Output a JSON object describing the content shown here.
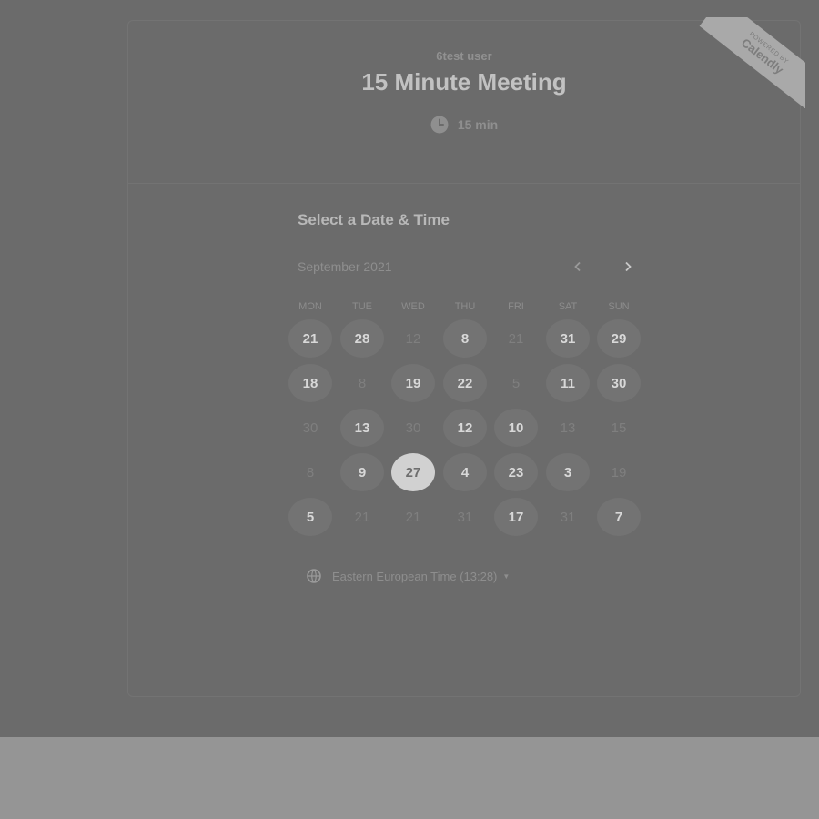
{
  "event": {
    "owner": "6test user",
    "title": "15 Minute Meeting",
    "duration": "15 min",
    "duration_icon": "clock-icon"
  },
  "ribbon": {
    "small": "POWERED BY",
    "brand": "Calendly"
  },
  "calendar": {
    "heading": "Select a Date & Time",
    "month": "September 2021",
    "prev_icon": "chevron-left-icon",
    "next_icon": "chevron-right-icon",
    "weekdays": [
      "MON",
      "TUE",
      "WED",
      "THU",
      "FRI",
      "SAT",
      "SUN"
    ],
    "days": [
      {
        "label": "21",
        "state": "available"
      },
      {
        "label": "28",
        "state": "available"
      },
      {
        "label": "12",
        "state": "unavailable"
      },
      {
        "label": "8",
        "state": "available"
      },
      {
        "label": "21",
        "state": "unavailable"
      },
      {
        "label": "31",
        "state": "available"
      },
      {
        "label": "29",
        "state": "available"
      },
      {
        "label": "18",
        "state": "available"
      },
      {
        "label": "8",
        "state": "unavailable"
      },
      {
        "label": "19",
        "state": "available"
      },
      {
        "label": "22",
        "state": "available"
      },
      {
        "label": "5",
        "state": "unavailable"
      },
      {
        "label": "11",
        "state": "available"
      },
      {
        "label": "30",
        "state": "available"
      },
      {
        "label": "30",
        "state": "unavailable"
      },
      {
        "label": "13",
        "state": "available"
      },
      {
        "label": "30",
        "state": "unavailable"
      },
      {
        "label": "12",
        "state": "available"
      },
      {
        "label": "10",
        "state": "available"
      },
      {
        "label": "13",
        "state": "unavailable"
      },
      {
        "label": "15",
        "state": "unavailable"
      },
      {
        "label": "8",
        "state": "unavailable"
      },
      {
        "label": "9",
        "state": "available"
      },
      {
        "label": "27",
        "state": "selected"
      },
      {
        "label": "4",
        "state": "available"
      },
      {
        "label": "23",
        "state": "available"
      },
      {
        "label": "3",
        "state": "available"
      },
      {
        "label": "19",
        "state": "unavailable"
      },
      {
        "label": "5",
        "state": "available"
      },
      {
        "label": "21",
        "state": "unavailable"
      },
      {
        "label": "21",
        "state": "unavailable"
      },
      {
        "label": "31",
        "state": "unavailable"
      },
      {
        "label": "17",
        "state": "available"
      },
      {
        "label": "31",
        "state": "unavailable"
      },
      {
        "label": "7",
        "state": "available"
      }
    ]
  },
  "timezone": {
    "label": "Eastern European Time (13:28)",
    "icon": "globe-icon"
  }
}
